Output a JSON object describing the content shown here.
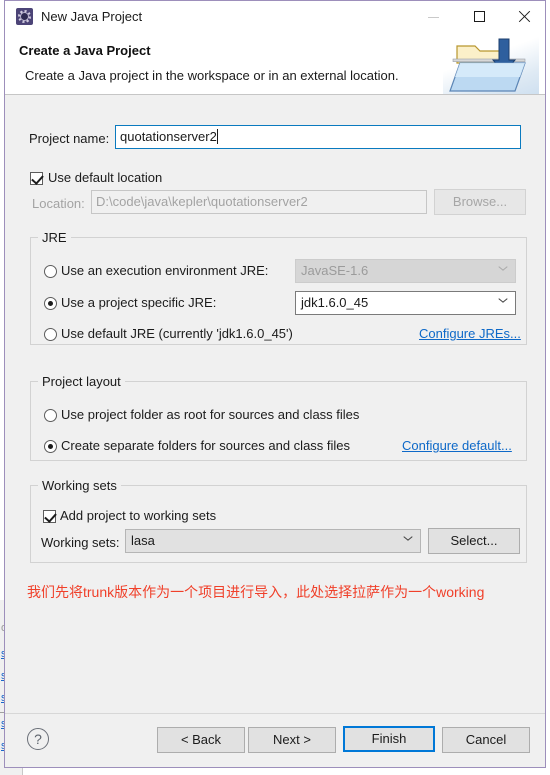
{
  "window": {
    "title": "New Java Project",
    "icon": "java-project-icon",
    "controls": {
      "minimize": "minimize-icon",
      "maximize": "maximize-icon",
      "close": "close-icon"
    }
  },
  "header": {
    "title": "Create a Java Project",
    "description": "Create a Java project in the workspace or in an external location.",
    "art": "java-folder-banner-icon"
  },
  "project": {
    "name_label": "Project name:",
    "name_value": "quotationserver2",
    "use_default_location_label": "Use default location",
    "use_default_location_checked": true,
    "location_label": "Location:",
    "location_value": "D:\\code\\java\\kepler\\quotationserver2",
    "browse_label": "Browse..."
  },
  "jre": {
    "group_title": "JRE",
    "option_exec_env_label": "Use an execution environment JRE:",
    "option_exec_env_selected": false,
    "exec_env_value": "JavaSE-1.6",
    "option_specific_label": "Use a project specific JRE:",
    "option_specific_selected": true,
    "specific_value": "jdk1.6.0_45",
    "option_default_label": "Use default JRE (currently 'jdk1.6.0_45')",
    "option_default_selected": false,
    "configure_link": "Configure JREs..."
  },
  "layout": {
    "group_title": "Project layout",
    "option_root_label": "Use project folder as root for sources and class files",
    "option_root_selected": false,
    "option_separate_label": "Create separate folders for sources and class files",
    "option_separate_selected": true,
    "configure_link": "Configure default..."
  },
  "working_sets": {
    "group_title": "Working sets",
    "add_label": "Add project to working sets",
    "add_checked": true,
    "sets_label": "Working sets:",
    "sets_value": "lasa",
    "select_label": "Select..."
  },
  "annotation": {
    "text": "我们先将trunk版本作为一个项目进行导入，此处选择拉萨作为一个working"
  },
  "footer": {
    "help": "?",
    "back_label": "< Back",
    "next_label": "Next >",
    "finish_label": "Finish",
    "cancel_label": "Cancel"
  },
  "background": {
    "fragments": [
      "ol",
      "su",
      "su",
      "su",
      "su",
      "su"
    ]
  },
  "colors": {
    "dialog_border": "#9d8fbb",
    "accent_focus": "#0078d7",
    "link": "#0e69c8",
    "annotation": "#f0402a",
    "body_bg": "#f0f0f0"
  }
}
